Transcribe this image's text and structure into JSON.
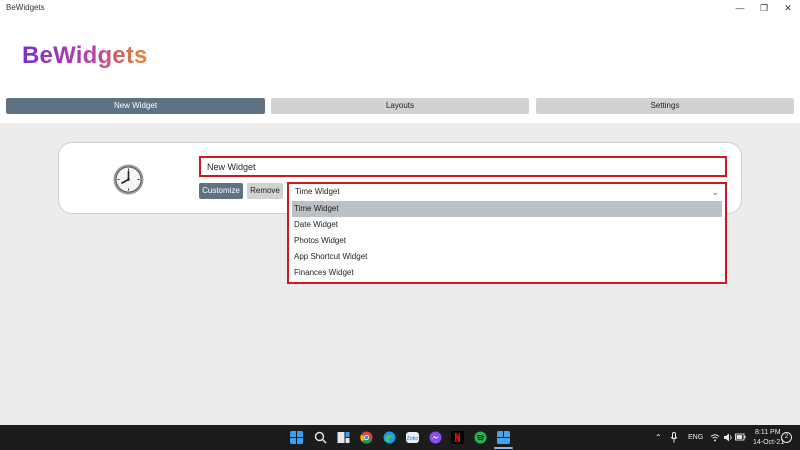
{
  "window": {
    "title": "BeWidgets"
  },
  "app": {
    "logo_text": "BeWidgets"
  },
  "tabs": [
    {
      "label": "New Widget",
      "active": true
    },
    {
      "label": "Layouts",
      "active": false
    },
    {
      "label": "Settings",
      "active": false
    }
  ],
  "widget": {
    "name_value": "New Widget",
    "customize_label": "Customize",
    "remove_label": "Remove",
    "type_selected": "Time Widget",
    "type_options": [
      "Time Widget",
      "Date Widget",
      "Photos Widget",
      "App Shortcut Widget",
      "Finances Widget"
    ],
    "highlight_color": "#d01822",
    "accent_color": "#5f7282"
  },
  "taskbar": {
    "icons": [
      "windows-start-icon",
      "search-icon",
      "task-view-icon",
      "chrome-icon",
      "edge-icon",
      "zoho-icon",
      "messenger-icon",
      "netflix-icon",
      "spotify-icon",
      "bewidgets-icon"
    ],
    "language": "ENG",
    "time": "8:11 PM",
    "date": "14-Oct-21",
    "notification_count": "2"
  }
}
